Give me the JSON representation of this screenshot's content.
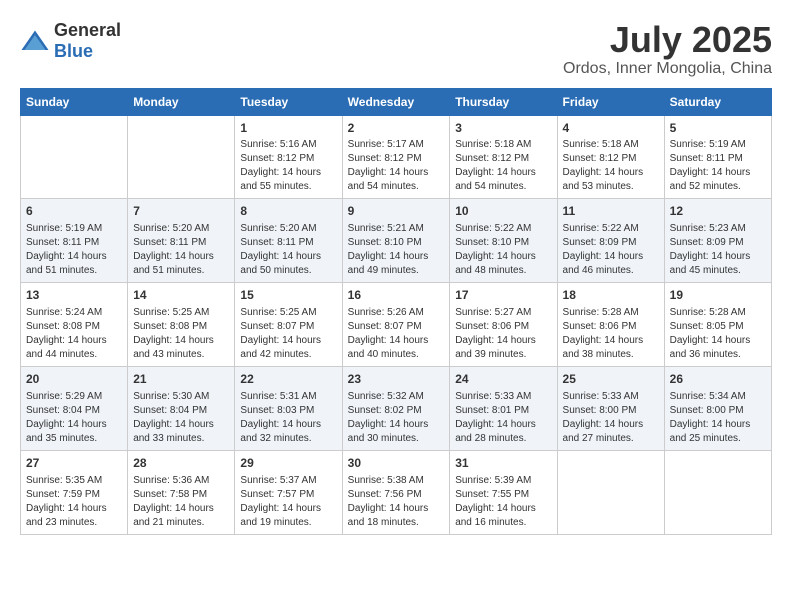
{
  "header": {
    "logo_general": "General",
    "logo_blue": "Blue",
    "month": "July 2025",
    "location": "Ordos, Inner Mongolia, China"
  },
  "weekdays": [
    "Sunday",
    "Monday",
    "Tuesday",
    "Wednesday",
    "Thursday",
    "Friday",
    "Saturday"
  ],
  "weeks": [
    [
      {
        "day": "",
        "sunrise": "",
        "sunset": "",
        "daylight": ""
      },
      {
        "day": "",
        "sunrise": "",
        "sunset": "",
        "daylight": ""
      },
      {
        "day": "1",
        "sunrise": "Sunrise: 5:16 AM",
        "sunset": "Sunset: 8:12 PM",
        "daylight": "Daylight: 14 hours and 55 minutes."
      },
      {
        "day": "2",
        "sunrise": "Sunrise: 5:17 AM",
        "sunset": "Sunset: 8:12 PM",
        "daylight": "Daylight: 14 hours and 54 minutes."
      },
      {
        "day": "3",
        "sunrise": "Sunrise: 5:18 AM",
        "sunset": "Sunset: 8:12 PM",
        "daylight": "Daylight: 14 hours and 54 minutes."
      },
      {
        "day": "4",
        "sunrise": "Sunrise: 5:18 AM",
        "sunset": "Sunset: 8:12 PM",
        "daylight": "Daylight: 14 hours and 53 minutes."
      },
      {
        "day": "5",
        "sunrise": "Sunrise: 5:19 AM",
        "sunset": "Sunset: 8:11 PM",
        "daylight": "Daylight: 14 hours and 52 minutes."
      }
    ],
    [
      {
        "day": "6",
        "sunrise": "Sunrise: 5:19 AM",
        "sunset": "Sunset: 8:11 PM",
        "daylight": "Daylight: 14 hours and 51 minutes."
      },
      {
        "day": "7",
        "sunrise": "Sunrise: 5:20 AM",
        "sunset": "Sunset: 8:11 PM",
        "daylight": "Daylight: 14 hours and 51 minutes."
      },
      {
        "day": "8",
        "sunrise": "Sunrise: 5:20 AM",
        "sunset": "Sunset: 8:11 PM",
        "daylight": "Daylight: 14 hours and 50 minutes."
      },
      {
        "day": "9",
        "sunrise": "Sunrise: 5:21 AM",
        "sunset": "Sunset: 8:10 PM",
        "daylight": "Daylight: 14 hours and 49 minutes."
      },
      {
        "day": "10",
        "sunrise": "Sunrise: 5:22 AM",
        "sunset": "Sunset: 8:10 PM",
        "daylight": "Daylight: 14 hours and 48 minutes."
      },
      {
        "day": "11",
        "sunrise": "Sunrise: 5:22 AM",
        "sunset": "Sunset: 8:09 PM",
        "daylight": "Daylight: 14 hours and 46 minutes."
      },
      {
        "day": "12",
        "sunrise": "Sunrise: 5:23 AM",
        "sunset": "Sunset: 8:09 PM",
        "daylight": "Daylight: 14 hours and 45 minutes."
      }
    ],
    [
      {
        "day": "13",
        "sunrise": "Sunrise: 5:24 AM",
        "sunset": "Sunset: 8:08 PM",
        "daylight": "Daylight: 14 hours and 44 minutes."
      },
      {
        "day": "14",
        "sunrise": "Sunrise: 5:25 AM",
        "sunset": "Sunset: 8:08 PM",
        "daylight": "Daylight: 14 hours and 43 minutes."
      },
      {
        "day": "15",
        "sunrise": "Sunrise: 5:25 AM",
        "sunset": "Sunset: 8:07 PM",
        "daylight": "Daylight: 14 hours and 42 minutes."
      },
      {
        "day": "16",
        "sunrise": "Sunrise: 5:26 AM",
        "sunset": "Sunset: 8:07 PM",
        "daylight": "Daylight: 14 hours and 40 minutes."
      },
      {
        "day": "17",
        "sunrise": "Sunrise: 5:27 AM",
        "sunset": "Sunset: 8:06 PM",
        "daylight": "Daylight: 14 hours and 39 minutes."
      },
      {
        "day": "18",
        "sunrise": "Sunrise: 5:28 AM",
        "sunset": "Sunset: 8:06 PM",
        "daylight": "Daylight: 14 hours and 38 minutes."
      },
      {
        "day": "19",
        "sunrise": "Sunrise: 5:28 AM",
        "sunset": "Sunset: 8:05 PM",
        "daylight": "Daylight: 14 hours and 36 minutes."
      }
    ],
    [
      {
        "day": "20",
        "sunrise": "Sunrise: 5:29 AM",
        "sunset": "Sunset: 8:04 PM",
        "daylight": "Daylight: 14 hours and 35 minutes."
      },
      {
        "day": "21",
        "sunrise": "Sunrise: 5:30 AM",
        "sunset": "Sunset: 8:04 PM",
        "daylight": "Daylight: 14 hours and 33 minutes."
      },
      {
        "day": "22",
        "sunrise": "Sunrise: 5:31 AM",
        "sunset": "Sunset: 8:03 PM",
        "daylight": "Daylight: 14 hours and 32 minutes."
      },
      {
        "day": "23",
        "sunrise": "Sunrise: 5:32 AM",
        "sunset": "Sunset: 8:02 PM",
        "daylight": "Daylight: 14 hours and 30 minutes."
      },
      {
        "day": "24",
        "sunrise": "Sunrise: 5:33 AM",
        "sunset": "Sunset: 8:01 PM",
        "daylight": "Daylight: 14 hours and 28 minutes."
      },
      {
        "day": "25",
        "sunrise": "Sunrise: 5:33 AM",
        "sunset": "Sunset: 8:00 PM",
        "daylight": "Daylight: 14 hours and 27 minutes."
      },
      {
        "day": "26",
        "sunrise": "Sunrise: 5:34 AM",
        "sunset": "Sunset: 8:00 PM",
        "daylight": "Daylight: 14 hours and 25 minutes."
      }
    ],
    [
      {
        "day": "27",
        "sunrise": "Sunrise: 5:35 AM",
        "sunset": "Sunset: 7:59 PM",
        "daylight": "Daylight: 14 hours and 23 minutes."
      },
      {
        "day": "28",
        "sunrise": "Sunrise: 5:36 AM",
        "sunset": "Sunset: 7:58 PM",
        "daylight": "Daylight: 14 hours and 21 minutes."
      },
      {
        "day": "29",
        "sunrise": "Sunrise: 5:37 AM",
        "sunset": "Sunset: 7:57 PM",
        "daylight": "Daylight: 14 hours and 19 minutes."
      },
      {
        "day": "30",
        "sunrise": "Sunrise: 5:38 AM",
        "sunset": "Sunset: 7:56 PM",
        "daylight": "Daylight: 14 hours and 18 minutes."
      },
      {
        "day": "31",
        "sunrise": "Sunrise: 5:39 AM",
        "sunset": "Sunset: 7:55 PM",
        "daylight": "Daylight: 14 hours and 16 minutes."
      },
      {
        "day": "",
        "sunrise": "",
        "sunset": "",
        "daylight": ""
      },
      {
        "day": "",
        "sunrise": "",
        "sunset": "",
        "daylight": ""
      }
    ]
  ]
}
